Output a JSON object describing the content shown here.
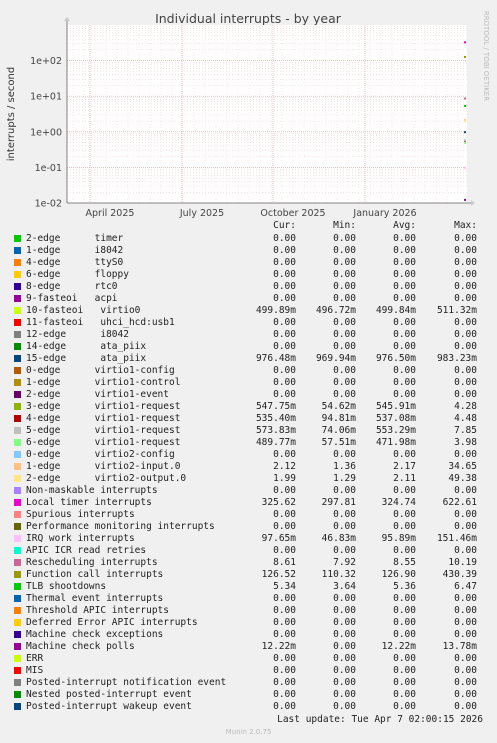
{
  "chart_data": {
    "type": "line",
    "title": "Individual interrupts - by year",
    "ylabel": "interrupts / second",
    "side_label": "RRDTOOL / TOBI OETIKER",
    "yscale": "log",
    "ylim": [
      0.01,
      1000
    ],
    "y_ticks": [
      "1e-02",
      "1e-01",
      "1e+00",
      "1e+01",
      "1e+02"
    ],
    "x_ticks": [
      "April 2025",
      "July 2025",
      "October 2025",
      "January 2026"
    ],
    "grid": true
  },
  "legend": {
    "headers": [
      "Cur:",
      "Min:",
      "Avg:",
      "Max:"
    ],
    "rows": [
      {
        "label": "2-edge      timer",
        "color": "#00cc00",
        "cur": "0.00",
        "min": "0.00",
        "avg": "0.00",
        "max": "0.00"
      },
      {
        "label": "1-edge      i8042",
        "color": "#0066b3",
        "cur": "0.00",
        "min": "0.00",
        "avg": "0.00",
        "max": "0.00"
      },
      {
        "label": "4-edge      ttyS0",
        "color": "#ff8000",
        "cur": "0.00",
        "min": "0.00",
        "avg": "0.00",
        "max": "0.00"
      },
      {
        "label": "6-edge      floppy",
        "color": "#ffcc00",
        "cur": "0.00",
        "min": "0.00",
        "avg": "0.00",
        "max": "0.00"
      },
      {
        "label": "8-edge      rtc0",
        "color": "#330099",
        "cur": "0.00",
        "min": "0.00",
        "avg": "0.00",
        "max": "0.00"
      },
      {
        "label": "9-fasteoi   acpi",
        "color": "#990099",
        "cur": "0.00",
        "min": "0.00",
        "avg": "0.00",
        "max": "0.00"
      },
      {
        "label": "10-fasteoi   virtio0",
        "color": "#ccff00",
        "cur": "499.89m",
        "min": "496.72m",
        "avg": "499.84m",
        "max": "511.32m"
      },
      {
        "label": "11-fasteoi   uhci_hcd:usb1",
        "color": "#ff0000",
        "cur": "0.00",
        "min": "0.00",
        "avg": "0.00",
        "max": "0.00"
      },
      {
        "label": "12-edge      i8042",
        "color": "#808080",
        "cur": "0.00",
        "min": "0.00",
        "avg": "0.00",
        "max": "0.00"
      },
      {
        "label": "14-edge      ata_piix",
        "color": "#008f00",
        "cur": "0.00",
        "min": "0.00",
        "avg": "0.00",
        "max": "0.00"
      },
      {
        "label": "15-edge      ata_piix",
        "color": "#00487d",
        "cur": "976.48m",
        "min": "969.94m",
        "avg": "976.50m",
        "max": "983.23m"
      },
      {
        "label": "0-edge      virtio1-config",
        "color": "#b35a00",
        "cur": "0.00",
        "min": "0.00",
        "avg": "0.00",
        "max": "0.00"
      },
      {
        "label": "1-edge      virtio1-control",
        "color": "#b38f00",
        "cur": "0.00",
        "min": "0.00",
        "avg": "0.00",
        "max": "0.00"
      },
      {
        "label": "2-edge      virtio1-event",
        "color": "#6b006b",
        "cur": "0.00",
        "min": "0.00",
        "avg": "0.00",
        "max": "0.00"
      },
      {
        "label": "3-edge      virtio1-request",
        "color": "#8fb300",
        "cur": "547.75m",
        "min": "54.62m",
        "avg": "545.91m",
        "max": "4.28"
      },
      {
        "label": "4-edge      virtio1-request",
        "color": "#b30000",
        "cur": "535.40m",
        "min": "94.81m",
        "avg": "537.08m",
        "max": "4.48"
      },
      {
        "label": "5-edge      virtio1-request",
        "color": "#bebebe",
        "cur": "573.83m",
        "min": "74.06m",
        "avg": "553.29m",
        "max": "7.85"
      },
      {
        "label": "6-edge      virtio1-request",
        "color": "#80ff80",
        "cur": "489.77m",
        "min": "57.51m",
        "avg": "471.98m",
        "max": "3.98"
      },
      {
        "label": "0-edge      virtio2-config",
        "color": "#80c9ff",
        "cur": "0.00",
        "min": "0.00",
        "avg": "0.00",
        "max": "0.00"
      },
      {
        "label": "1-edge      virtio2-input.0",
        "color": "#ffc080",
        "cur": "2.12",
        "min": "1.36",
        "avg": "2.17",
        "max": "34.65"
      },
      {
        "label": "2-edge      virtio2-output.0",
        "color": "#ffe680",
        "cur": "1.99",
        "min": "1.29",
        "avg": "2.11",
        "max": "49.38"
      },
      {
        "label": "Non-maskable interrupts",
        "color": "#aa80ff",
        "cur": "0.00",
        "min": "0.00",
        "avg": "0.00",
        "max": "0.00"
      },
      {
        "label": "Local timer interrupts",
        "color": "#ee00cc",
        "cur": "325.62",
        "min": "297.81",
        "avg": "324.74",
        "max": "622.61"
      },
      {
        "label": "Spurious interrupts",
        "color": "#ff8080",
        "cur": "0.00",
        "min": "0.00",
        "avg": "0.00",
        "max": "0.00"
      },
      {
        "label": "Performance monitoring interrupts",
        "color": "#666600",
        "cur": "0.00",
        "min": "0.00",
        "avg": "0.00",
        "max": "0.00"
      },
      {
        "label": "IRQ work interrupts",
        "color": "#ffbfff",
        "cur": "97.65m",
        "min": "46.83m",
        "avg": "95.89m",
        "max": "151.46m"
      },
      {
        "label": "APIC ICR read retries",
        "color": "#00ffcc",
        "cur": "0.00",
        "min": "0.00",
        "avg": "0.00",
        "max": "0.00"
      },
      {
        "label": "Rescheduling interrupts",
        "color": "#cc6699",
        "cur": "8.61",
        "min": "7.92",
        "avg": "8.55",
        "max": "10.19"
      },
      {
        "label": "Function call interrupts",
        "color": "#999900",
        "cur": "126.52",
        "min": "110.32",
        "avg": "126.90",
        "max": "430.39"
      },
      {
        "label": "TLB shootdowns",
        "color": "#00cc00",
        "cur": "5.34",
        "min": "3.64",
        "avg": "5.36",
        "max": "6.47"
      },
      {
        "label": "Thermal event interrupts",
        "color": "#0066b3",
        "cur": "0.00",
        "min": "0.00",
        "avg": "0.00",
        "max": "0.00"
      },
      {
        "label": "Threshold APIC interrupts",
        "color": "#ff8000",
        "cur": "0.00",
        "min": "0.00",
        "avg": "0.00",
        "max": "0.00"
      },
      {
        "label": "Deferred Error APIC interrupts",
        "color": "#ffcc00",
        "cur": "0.00",
        "min": "0.00",
        "avg": "0.00",
        "max": "0.00"
      },
      {
        "label": "Machine check exceptions",
        "color": "#330099",
        "cur": "0.00",
        "min": "0.00",
        "avg": "0.00",
        "max": "0.00"
      },
      {
        "label": "Machine check polls",
        "color": "#990099",
        "cur": "12.22m",
        "min": "0.00",
        "avg": "12.22m",
        "max": "13.78m"
      },
      {
        "label": "ERR",
        "color": "#ccff00",
        "cur": "0.00",
        "min": "0.00",
        "avg": "0.00",
        "max": "0.00"
      },
      {
        "label": "MIS",
        "color": "#ff0000",
        "cur": "0.00",
        "min": "0.00",
        "avg": "0.00",
        "max": "0.00"
      },
      {
        "label": "Posted-interrupt notification event",
        "color": "#808080",
        "cur": "0.00",
        "min": "0.00",
        "avg": "0.00",
        "max": "0.00"
      },
      {
        "label": "Nested posted-interrupt event",
        "color": "#008f00",
        "cur": "0.00",
        "min": "0.00",
        "avg": "0.00",
        "max": "0.00"
      },
      {
        "label": "Posted-interrupt wakeup event",
        "color": "#00487d",
        "cur": "0.00",
        "min": "0.00",
        "avg": "0.00",
        "max": "0.00"
      }
    ]
  },
  "last_update": "Last update: Tue Apr  7 02:00:15 2026",
  "footer": "Munin 2.0.75"
}
